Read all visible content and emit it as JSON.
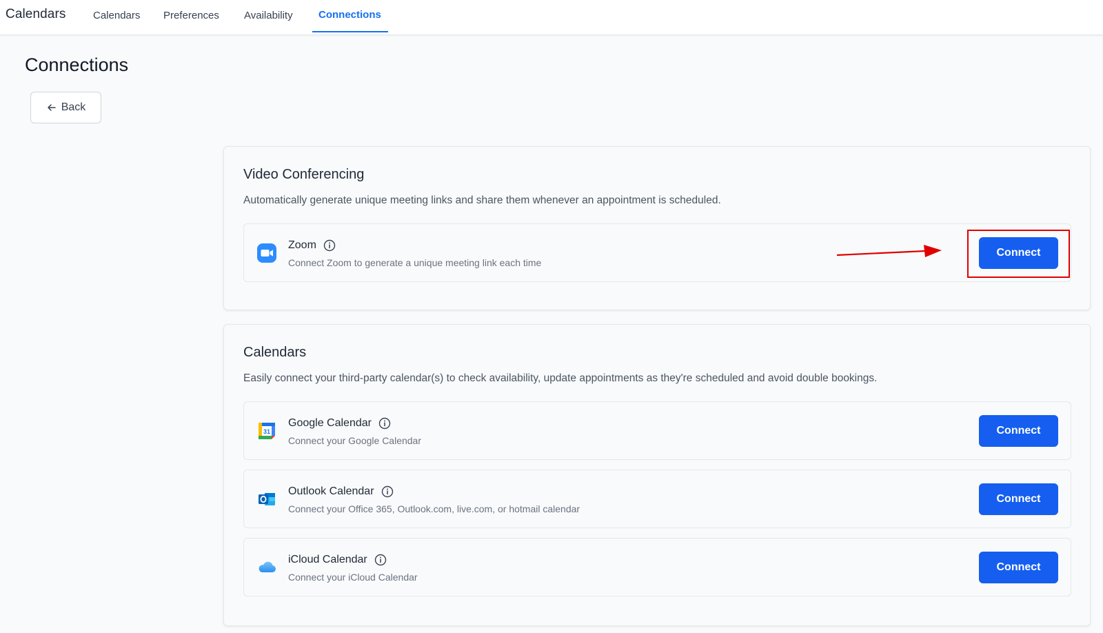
{
  "header": {
    "app_title": "Calendars",
    "tabs": [
      {
        "label": "Calendars",
        "active": false
      },
      {
        "label": "Preferences",
        "active": false
      },
      {
        "label": "Availability",
        "active": false
      },
      {
        "label": "Connections",
        "active": true
      }
    ]
  },
  "page": {
    "title": "Connections",
    "back_label": "Back"
  },
  "video_conferencing": {
    "title": "Video Conferencing",
    "description": "Automatically generate unique meeting links and share them whenever an appointment is scheduled.",
    "items": [
      {
        "name": "Zoom",
        "description": "Connect Zoom to generate a unique meeting link each time",
        "button": "Connect",
        "icon": "zoom-icon"
      }
    ]
  },
  "calendars": {
    "title": "Calendars",
    "description": "Easily connect your third-party calendar(s) to check availability, update appointments as they're scheduled and avoid double bookings.",
    "items": [
      {
        "name": "Google Calendar",
        "description": "Connect your Google Calendar",
        "button": "Connect",
        "icon": "google-calendar-icon"
      },
      {
        "name": "Outlook Calendar",
        "description": "Connect your Office 365, Outlook.com, live.com, or hotmail calendar",
        "button": "Connect",
        "icon": "outlook-icon"
      },
      {
        "name": "iCloud Calendar",
        "description": "Connect your iCloud Calendar",
        "button": "Connect",
        "icon": "icloud-icon"
      }
    ],
    "google_icon_text": "31"
  },
  "colors": {
    "accent": "#1570ef",
    "button": "#155eef",
    "annotation": "#e00000"
  }
}
